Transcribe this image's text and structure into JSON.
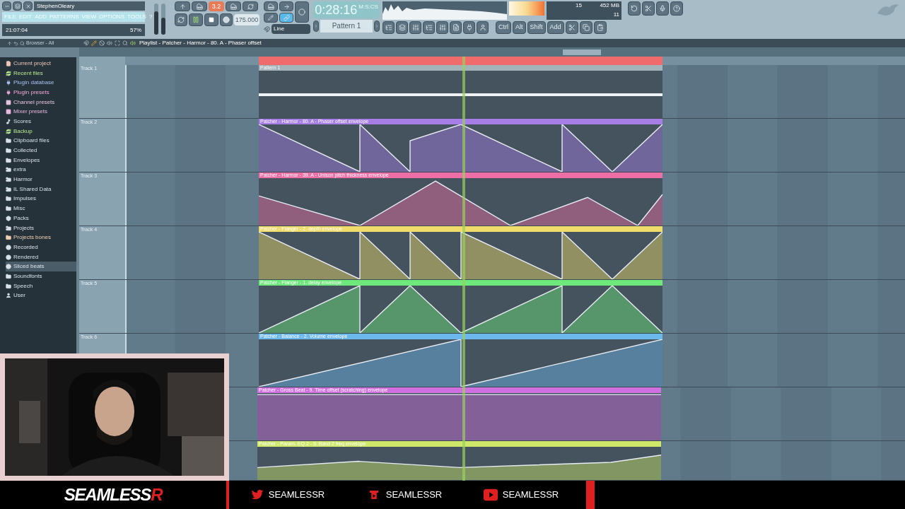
{
  "window": {
    "title": "StephenOleary",
    "menu": [
      "FILE",
      "EDIT",
      "ADD",
      "PATTERNS",
      "VIEW",
      "OPTIONS",
      "TOOLS",
      "?"
    ],
    "hint_time": "21:07:04",
    "cpu": "57%"
  },
  "sliders": [
    {
      "level": 0.75
    },
    {
      "level": 0.55
    }
  ],
  "transport": {
    "playing": true,
    "time_sig": "3.2",
    "tempo": "175.000",
    "snap": "Line",
    "song_time": "0:28:16",
    "time_unit": "M:S:CS",
    "pattern": "Pattern 1",
    "polyphony": "15",
    "memory": "452 MB",
    "voices": "11"
  },
  "toolbar_keys": [
    "Ctrl",
    "Alt",
    "Shift",
    "Add"
  ],
  "browser": {
    "title": "Browser - All",
    "items": [
      {
        "label": "Current project",
        "kind": "project",
        "color": "#f0c8b8",
        "selected": false
      },
      {
        "label": "Recent files",
        "kind": "recent",
        "color": "#b8e890",
        "selected": false
      },
      {
        "label": "Plugin database",
        "kind": "plugin",
        "color": "#a8c0f0",
        "selected": false
      },
      {
        "label": "Plugin presets",
        "kind": "plugin",
        "color": "#f0a8d8",
        "selected": false
      },
      {
        "label": "Channel presets",
        "kind": "channel",
        "color": "#e8c0e0",
        "selected": false
      },
      {
        "label": "Mixer presets",
        "kind": "mixer",
        "color": "#e8b8e0",
        "selected": false
      },
      {
        "label": "Scores",
        "kind": "note",
        "color": "#d8e0e8",
        "selected": false
      },
      {
        "label": "Backup",
        "kind": "recent",
        "color": "#b8e890",
        "selected": false
      },
      {
        "label": "Clipboard files",
        "kind": "folder",
        "color": "#d8e0e8",
        "selected": false
      },
      {
        "label": "Collected",
        "kind": "folder",
        "color": "#d8e0e8",
        "selected": false
      },
      {
        "label": "Envelopes",
        "kind": "folder",
        "color": "#d8e0e8",
        "selected": false
      },
      {
        "label": "extra",
        "kind": "link",
        "color": "#d8e0e8",
        "selected": false
      },
      {
        "label": "Harmor",
        "kind": "link",
        "color": "#d8e0e8",
        "selected": false
      },
      {
        "label": "IL Shared Data",
        "kind": "link",
        "color": "#d8e0e8",
        "selected": false
      },
      {
        "label": "Impulses",
        "kind": "folder",
        "color": "#d8e0e8",
        "selected": false
      },
      {
        "label": "Misc",
        "kind": "folder",
        "color": "#d8e0e8",
        "selected": false
      },
      {
        "label": "Packs",
        "kind": "pack",
        "color": "#d8e0e8",
        "selected": false
      },
      {
        "label": "Projects",
        "kind": "link",
        "color": "#d8e0e8",
        "selected": false
      },
      {
        "label": "Projects bones",
        "kind": "folder",
        "color": "#f0d0b0",
        "selected": false
      },
      {
        "label": "Recorded",
        "kind": "audio",
        "color": "#d8e0e8",
        "selected": false
      },
      {
        "label": "Rendered",
        "kind": "audio",
        "color": "#d8e0e8",
        "selected": false
      },
      {
        "label": "Sliced beats",
        "kind": "audio",
        "color": "#d8e0e8",
        "selected": true
      },
      {
        "label": "Soundfonts",
        "kind": "folder",
        "color": "#d8e0e8",
        "selected": false
      },
      {
        "label": "Speech",
        "kind": "folder",
        "color": "#d8e0e8",
        "selected": false
      },
      {
        "label": "User",
        "kind": "user",
        "color": "#d8e0e8",
        "selected": false
      }
    ]
  },
  "playlist": {
    "title": "Playlist - Patcher - Harmor - 80. A - Phaser offset",
    "tracks": [
      {
        "name": "Track 1",
        "clip": {
          "kind": "pattern",
          "label": "Pattern 1",
          "color": "#a4b2ba"
        }
      },
      {
        "name": "Track 2",
        "clip": {
          "kind": "automation",
          "label": "Patcher - Harmor - 80. A - Phaser offset envelope",
          "color": "#a67ee6"
        }
      },
      {
        "name": "Track 3",
        "clip": {
          "kind": "automation",
          "label": "Patcher - Harmor - 39. A - Unison pitch thickness envelope",
          "color": "#ee6fa6"
        }
      },
      {
        "name": "Track 4",
        "clip": {
          "kind": "automation",
          "label": "Patcher - Flanger - 2. depth envelope",
          "color": "#f0dc6a"
        }
      },
      {
        "name": "Track 5",
        "clip": {
          "kind": "automation",
          "label": "Patcher - Flanger - 1. delay envelope",
          "color": "#6ee87a"
        }
      },
      {
        "name": "Track 6",
        "clip": {
          "kind": "automation",
          "label": "Patcher - Balance - 2. Volume envelope",
          "color": "#6cb8ec"
        }
      },
      {
        "clip": {
          "kind": "automation",
          "label": "Patcher - Gross Beat - 9. Time offset (scratching) envelope",
          "color": "#d070e0"
        }
      },
      {
        "clip": {
          "kind": "automation",
          "label": "Patcher - Param. EQ 2 - 9. Band 2 freq envelope",
          "color": "#cfe86a"
        }
      }
    ]
  },
  "stream": {
    "logo": "SEAMLESS",
    "logo_accent": "R",
    "links": [
      {
        "kind": "twitter",
        "label": "SEAMLESSR"
      },
      {
        "kind": "play",
        "label": "SEAMLESSR"
      },
      {
        "kind": "youtube",
        "label": "SEAMLESSR"
      }
    ]
  }
}
